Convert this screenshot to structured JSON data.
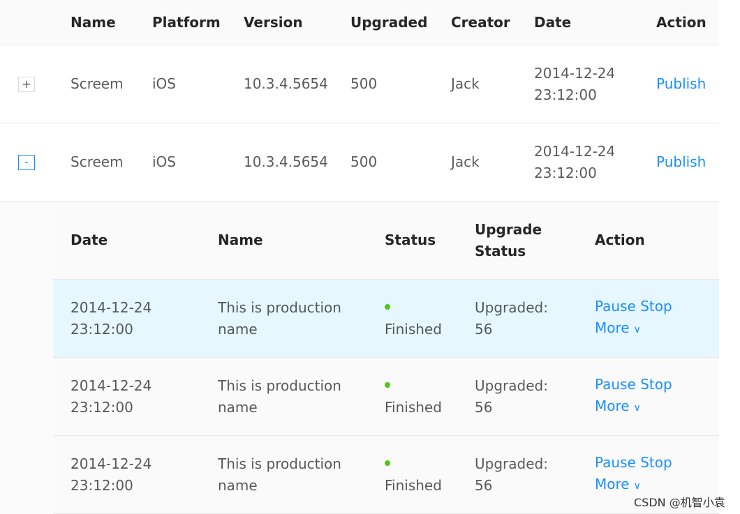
{
  "outer_table": {
    "headers": {
      "name": "Name",
      "platform": "Platform",
      "version": "Version",
      "upgraded": "Upgraded",
      "creator": "Creator",
      "date": "Date",
      "action": "Action"
    },
    "rows": [
      {
        "expand_symbol": "+",
        "expanded": false,
        "name": "Screem",
        "platform": "iOS",
        "version": "10.3.4.5654",
        "upgraded": "500",
        "creator": "Jack",
        "date_line1": "2014-12-24",
        "date_line2": "23:12:00",
        "action": "Publish"
      },
      {
        "expand_symbol": "-",
        "expanded": true,
        "name": "Screem",
        "platform": "iOS",
        "version": "10.3.4.5654",
        "upgraded": "500",
        "creator": "Jack",
        "date_line1": "2014-12-24",
        "date_line2": "23:12:00",
        "action": "Publish"
      }
    ]
  },
  "inner_table": {
    "headers": {
      "date": "Date",
      "name": "Name",
      "status": "Status",
      "upgrade_status_line1": "Upgrade",
      "upgrade_status_line2": "Status",
      "action": "Action"
    },
    "rows": [
      {
        "highlighted": true,
        "date_line1": "2014-12-24",
        "date_line2": "23:12:00",
        "name_line1": "This is production",
        "name_line2": "name",
        "status": "Finished",
        "upgrade_line1": "Upgraded:",
        "upgrade_line2": "56",
        "pause": "Pause",
        "stop": "Stop",
        "more": "More"
      },
      {
        "highlighted": false,
        "date_line1": "2014-12-24",
        "date_line2": "23:12:00",
        "name_line1": "This is production",
        "name_line2": "name",
        "status": "Finished",
        "upgrade_line1": "Upgraded:",
        "upgrade_line2": "56",
        "pause": "Pause",
        "stop": "Stop",
        "more": "More"
      },
      {
        "highlighted": false,
        "date_line1": "2014-12-24",
        "date_line2": "23:12:00",
        "name_line1": "This is production",
        "name_line2": "name",
        "status": "Finished",
        "upgrade_line1": "Upgraded:",
        "upgrade_line2": "56",
        "pause": "Pause",
        "stop": "Stop",
        "more": "More"
      }
    ]
  },
  "colors": {
    "link": "#1890ff",
    "status_success": "#52c41a",
    "row_highlight": "#e6f7ff",
    "header_bg": "#fafafa",
    "border": "#e8e8e8"
  },
  "icons": {
    "expand": "plus-square-icon",
    "collapse": "minus-square-icon",
    "more": "chevron-down-icon",
    "status": "status-dot-icon"
  },
  "watermark": "CSDN @机智小袁"
}
